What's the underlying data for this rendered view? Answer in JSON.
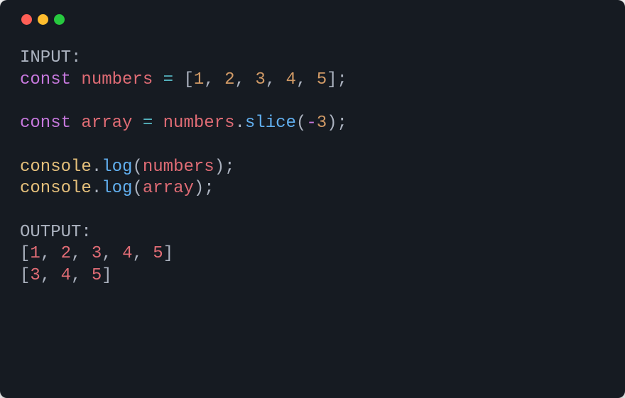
{
  "titlebar": {
    "buttons": [
      {
        "name": "close",
        "color": "#ff5f56"
      },
      {
        "name": "minimize",
        "color": "#ffbd2e"
      },
      {
        "name": "zoom",
        "color": "#27c93f"
      }
    ]
  },
  "labels": {
    "input": "INPUT:",
    "output": "OUTPUT:"
  },
  "code": {
    "line1": {
      "keyword": "const",
      "var": "numbers",
      "op": "=",
      "vals": [
        "1",
        "2",
        "3",
        "4",
        "5"
      ]
    },
    "line2": {
      "keyword": "const",
      "var": "array",
      "op": "=",
      "src": "numbers",
      "method": "slice",
      "argMinus": "-",
      "argNum": "3"
    },
    "line3": {
      "obj": "console",
      "method": "log",
      "arg": "numbers"
    },
    "line4": {
      "obj": "console",
      "method": "log",
      "arg": "array"
    }
  },
  "output": {
    "row1": [
      "1",
      "2",
      "3",
      "4",
      "5"
    ],
    "row2": [
      "3",
      "4",
      "5"
    ]
  }
}
